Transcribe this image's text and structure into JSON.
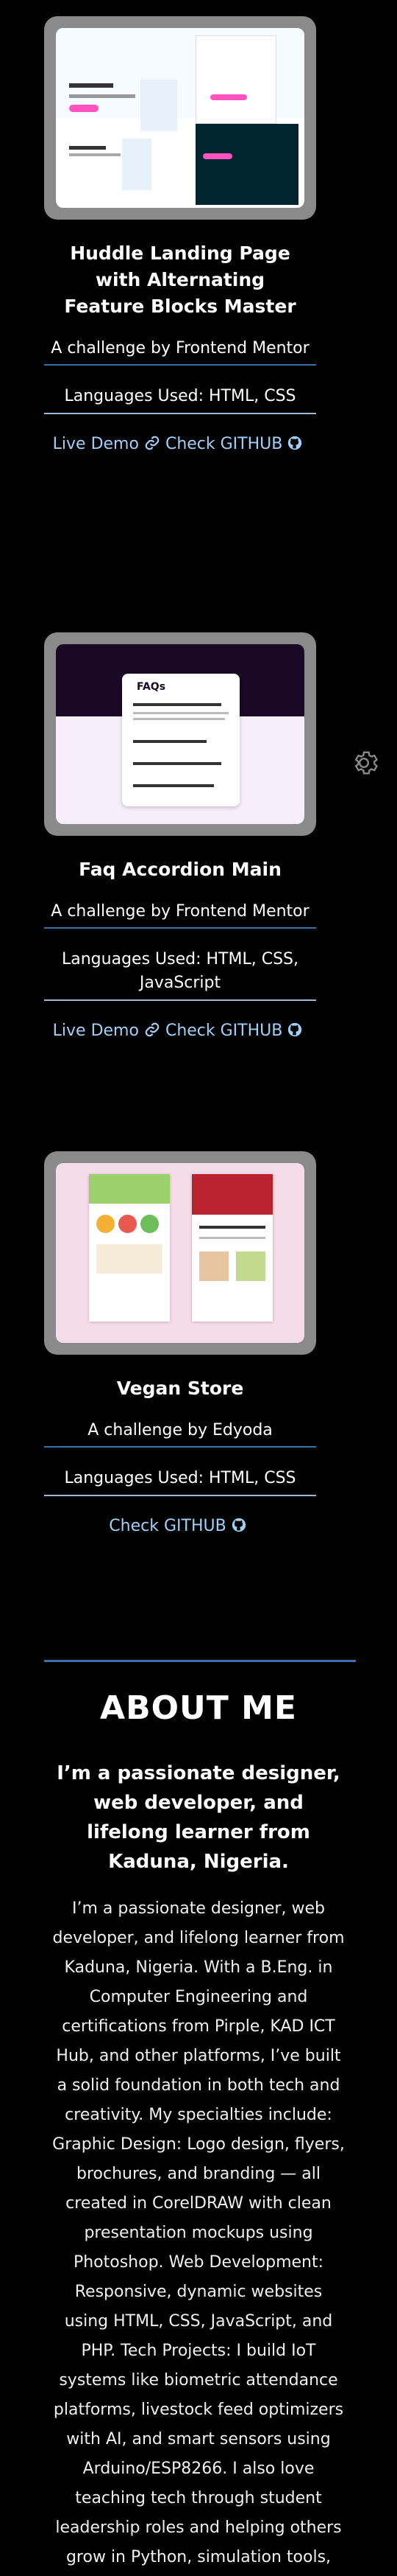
{
  "projects": [
    {
      "title": "Huddle Landing Page with Alternating Feature Blocks Master",
      "by": "A challenge by Frontend Mentor",
      "languages": "Languages Used: HTML, CSS",
      "live_demo": "Live Demo",
      "github": "Check GITHUB"
    },
    {
      "title": "Faq Accordion Main",
      "by": "A challenge by Frontend Mentor",
      "languages": "Languages Used: HTML, CSS, JavaScript",
      "live_demo": "Live Demo",
      "github": "Check GITHUB",
      "thumb_title": "FAQs"
    },
    {
      "title": "Vegan Store",
      "by": "A challenge by Edyoda",
      "languages": "Languages Used: HTML, CSS",
      "github": "Check GITHUB"
    }
  ],
  "about": {
    "heading": "ABOUT ME",
    "subheading": "I’m a passionate designer, web developer, and lifelong learner from Kaduna, Nigeria.",
    "body": "I’m a passionate designer, web developer, and lifelong learner from Kaduna, Nigeria. With a B.Eng. in Computer Engineering and certifications from Pirple, KAD ICT Hub, and other platforms, I’ve built a solid foundation in both tech and creativity. My specialties include: Graphic Design: Logo design, flyers, brochures, and branding — all created in CorelDRAW with clean presentation mockups using Photoshop. Web Development: Responsive, dynamic websites using HTML, CSS, JavaScript, and PHP. Tech Projects: I build IoT systems like biometric attendance platforms, livestock feed optimizers with AI, and smart sensors using Arduino/ESP8266. I also love teaching tech through student leadership roles and helping others grow in Python, simulation tools, and design. When I’m not"
  },
  "colors": {
    "background": "#000000",
    "accent": "#3b6fa8",
    "link": "#9fd0f7"
  },
  "icons": {
    "link": "link-icon",
    "github": "github-icon",
    "settings": "gear-icon"
  }
}
